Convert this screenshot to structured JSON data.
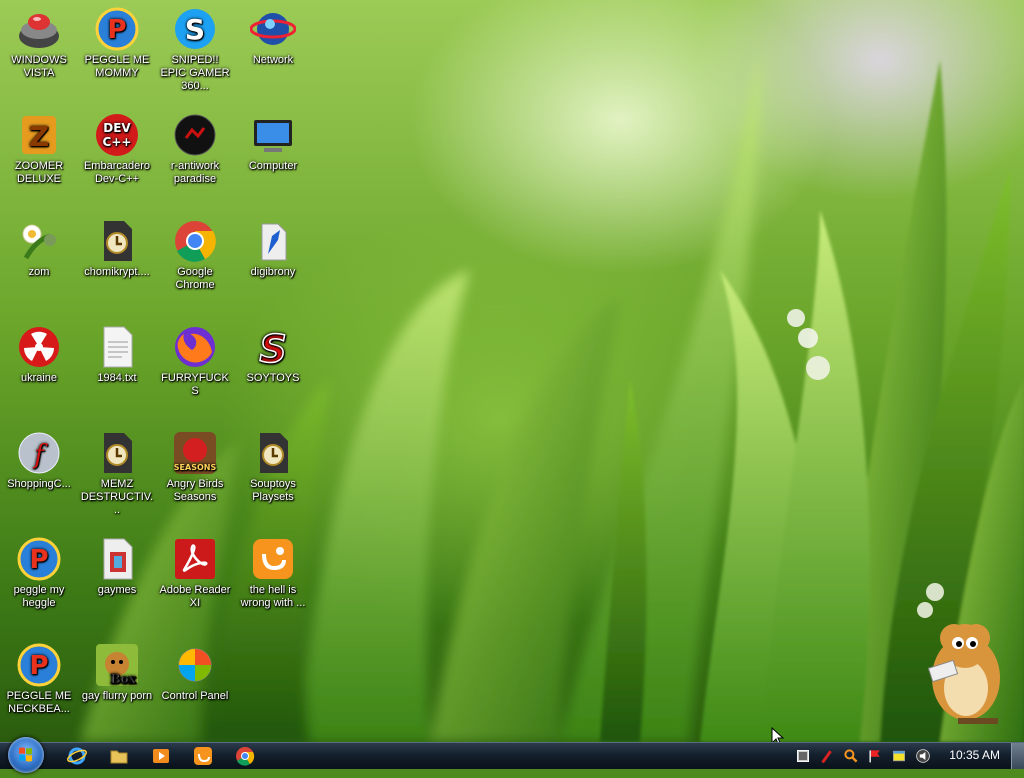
{
  "desktop": {
    "icons": [
      {
        "label": "WINDOWS VISTA",
        "icon": "vista-bowl-icon"
      },
      {
        "label": "PEGGLE ME MOMMY",
        "icon": "peggle-icon"
      },
      {
        "label": "SNIPED!! EPIC GAMER 360...",
        "icon": "skype-icon"
      },
      {
        "label": "Network",
        "icon": "network-globe-icon"
      },
      {
        "label": "ZOOMER DELUXE",
        "icon": "zoomer-deluxe-icon"
      },
      {
        "label": "Embarcadero Dev-C++",
        "icon": "devcpp-icon"
      },
      {
        "label": "r-antiwork paradise",
        "icon": "antiwork-icon"
      },
      {
        "label": "Computer",
        "icon": "computer-icon"
      },
      {
        "label": "zom",
        "icon": "zombie-plant-icon"
      },
      {
        "label": "chomikrypt....",
        "icon": "clock-file-icon"
      },
      {
        "label": "Google Chrome",
        "icon": "chrome-icon"
      },
      {
        "label": "digibrony",
        "icon": "digibrony-icon"
      },
      {
        "label": "ukraine",
        "icon": "radiation-icon"
      },
      {
        "label": "1984.txt",
        "icon": "text-file-icon"
      },
      {
        "label": "FURRYFUCKS",
        "icon": "firefox-icon"
      },
      {
        "label": "SOYTOYS",
        "icon": "soytoys-icon"
      },
      {
        "label": "ShoppingC...",
        "icon": "flash-icon"
      },
      {
        "label": "MEMZ DESTRUCTIV...",
        "icon": "clock-file-icon"
      },
      {
        "label": "Angry Birds Seasons",
        "icon": "angry-birds-icon"
      },
      {
        "label": "Souptoys Playsets",
        "icon": "clock-file-icon"
      },
      {
        "label": "peggle my heggle",
        "icon": "peggle-icon"
      },
      {
        "label": "gaymes",
        "icon": "media-file-icon"
      },
      {
        "label": "Adobe Reader XI",
        "icon": "adobe-reader-icon"
      },
      {
        "label": "the hell is wrong with ...",
        "icon": "uc-browser-icon"
      },
      {
        "label": "PEGGLE ME NECKBEA...",
        "icon": "peggle-icon"
      },
      {
        "label": "gay flurry porn",
        "icon": "hamster-box-icon"
      },
      {
        "label": "Control Panel",
        "icon": "control-panel-icon"
      }
    ]
  },
  "taskbar": {
    "quick_launch": [
      {
        "icon": "internet-explorer-icon"
      },
      {
        "icon": "folder-icon"
      },
      {
        "icon": "media-player-icon"
      },
      {
        "icon": "uc-browser-icon"
      },
      {
        "icon": "chrome-icon"
      }
    ],
    "tray_icons": [
      {
        "icon": "network-tray-icon"
      },
      {
        "icon": "pen-tray-icon"
      },
      {
        "icon": "search-tray-icon"
      },
      {
        "icon": "flag-tray-icon"
      },
      {
        "icon": "notes-tray-icon"
      },
      {
        "icon": "speaker-tray-icon"
      }
    ],
    "clock": "10:35 AM"
  },
  "colors": {
    "taskbar": "#14202d",
    "wallpaper_green": "#6aa52a",
    "start_orb": "#2e6fc4"
  }
}
